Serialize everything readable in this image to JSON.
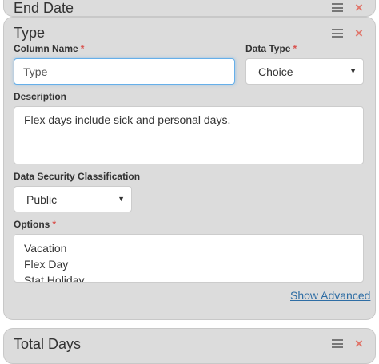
{
  "panels": {
    "top": {
      "title": "End Date"
    },
    "main": {
      "title": "Type",
      "column_name": {
        "label": "Column Name",
        "required_mark": "*",
        "placeholder": "Type"
      },
      "data_type": {
        "label": "Data Type",
        "required_mark": "*",
        "value": "Choice"
      },
      "description": {
        "label": "Description",
        "value": "Flex days include sick and personal days."
      },
      "security": {
        "label": "Data Security Classification",
        "value": "Public"
      },
      "options": {
        "label": "Options",
        "required_mark": "*",
        "items": [
          "Vacation",
          "Flex Day",
          "Stat Holiday"
        ]
      },
      "show_advanced": "Show Advanced"
    },
    "bottom": {
      "title": "Total Days"
    }
  },
  "icons": {
    "menu": "menu-icon",
    "close": "close-icon",
    "dropdown": "chevron-down-icon"
  },
  "glyphs": {
    "close": "×",
    "caret": "▼"
  },
  "colors": {
    "panel_bg": "#dcdcdc",
    "close": "#e0756a",
    "required": "#d9534f",
    "link": "#2e6da4",
    "focus": "#66afe9"
  }
}
